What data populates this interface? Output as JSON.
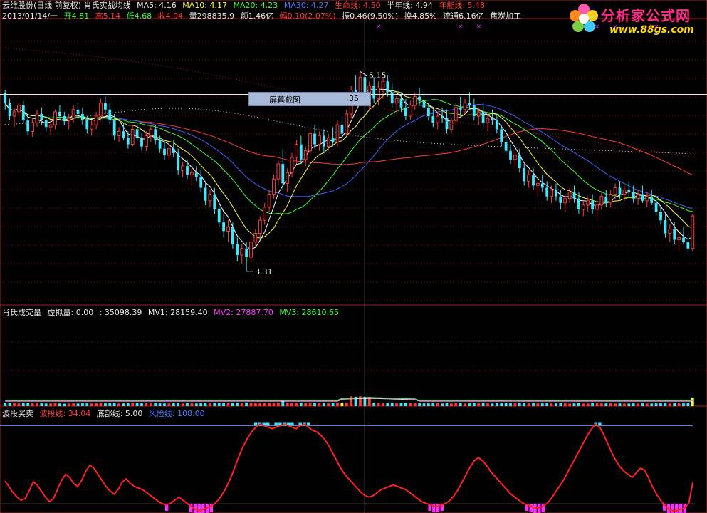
{
  "header": {
    "title": "云维股份(日线 前复权) 肖氏实战均线",
    "ma5": "MA5: 4.16",
    "ma10": "MA10: 4.17",
    "ma20": "MA20: 4.23",
    "ma30": "MA30: 4.27",
    "life_line": "生命线: 4.50",
    "half_year": "半年线: 4.94",
    "annual_line": "年能线: 5.48",
    "date": "2013/01/14/一",
    "open": "开4.81",
    "high": "高5.14",
    "low": "低4.68",
    "close": "收4.94",
    "volume": "量298835.9",
    "amount": "额1.46亿",
    "change": "幅0.10(2.07%)",
    "amplitude": "振0.46(9.50%)",
    "turnover": "换4.85%",
    "float": "流通6.16亿",
    "industry": "焦炭加工"
  },
  "logo": {
    "title": "分析家公式网",
    "url": "www.88gs.com"
  },
  "tooltip": {
    "label": "屏幕截图",
    "value": "35"
  },
  "volume_panel": {
    "title": "肖氏成交量",
    "virtual": "虚拟量: 0.00",
    "value": ": 35098.39",
    "mv1": "MV1: 28159.40",
    "mv2": "MV2: 27887.70",
    "mv3": "MV3: 28610.65"
  },
  "osc_panel": {
    "title": "波段买卖",
    "band": "波段线: 34.04",
    "bottom": "底部线: 5.00",
    "risk": "风险线: 108.00"
  },
  "colors": {
    "up": "#ff3a3a",
    "down": "#40e8ff",
    "ma5": "#ffffff",
    "ma10": "#ffff40",
    "ma20": "#3aff3a",
    "ma30": "#4060ff",
    "life": "#ff3a3a",
    "grid": "#7a1010"
  },
  "chart_data": [
    {
      "type": "candlestick",
      "title": "云维股份(日线 前复权) 肖氏实战均线",
      "ylim": [
        3.0,
        5.6
      ],
      "crosshair_price": 4.94,
      "annotations": [
        {
          "text": "5.15",
          "index": 78,
          "value": 5.15
        },
        {
          "text": "3.31",
          "index": 53,
          "value": 3.31
        }
      ],
      "ohlc": [
        [
          4.95,
          4.98,
          4.8,
          4.86
        ],
        [
          4.86,
          4.9,
          4.7,
          4.74
        ],
        [
          4.74,
          4.82,
          4.64,
          4.78
        ],
        [
          4.78,
          4.86,
          4.72,
          4.84
        ],
        [
          4.84,
          4.88,
          4.68,
          4.7
        ],
        [
          4.7,
          4.76,
          4.56,
          4.6
        ],
        [
          4.6,
          4.72,
          4.55,
          4.68
        ],
        [
          4.68,
          4.8,
          4.64,
          4.76
        ],
        [
          4.76,
          4.82,
          4.66,
          4.7
        ],
        [
          4.7,
          4.74,
          4.6,
          4.64
        ],
        [
          4.64,
          4.7,
          4.56,
          4.66
        ],
        [
          4.66,
          4.8,
          4.62,
          4.78
        ],
        [
          4.78,
          4.84,
          4.7,
          4.74
        ],
        [
          4.74,
          4.78,
          4.66,
          4.7
        ],
        [
          4.7,
          4.76,
          4.62,
          4.72
        ],
        [
          4.72,
          4.84,
          4.68,
          4.8
        ],
        [
          4.8,
          4.86,
          4.72,
          4.76
        ],
        [
          4.76,
          4.82,
          4.66,
          4.7
        ],
        [
          4.7,
          4.74,
          4.58,
          4.62
        ],
        [
          4.62,
          4.7,
          4.56,
          4.66
        ],
        [
          4.66,
          4.78,
          4.62,
          4.74
        ],
        [
          4.74,
          4.9,
          4.7,
          4.86
        ],
        [
          4.86,
          4.92,
          4.76,
          4.8
        ],
        [
          4.8,
          4.86,
          4.66,
          4.7
        ],
        [
          4.7,
          4.76,
          4.52,
          4.56
        ],
        [
          4.56,
          4.64,
          4.5,
          4.6
        ],
        [
          4.6,
          4.68,
          4.52,
          4.54
        ],
        [
          4.54,
          4.6,
          4.44,
          4.48
        ],
        [
          4.48,
          4.66,
          4.46,
          4.62
        ],
        [
          4.62,
          4.68,
          4.5,
          4.54
        ],
        [
          4.54,
          4.58,
          4.42,
          4.46
        ],
        [
          4.46,
          4.6,
          4.42,
          4.56
        ],
        [
          4.56,
          4.66,
          4.5,
          4.62
        ],
        [
          4.62,
          4.66,
          4.48,
          4.52
        ],
        [
          4.52,
          4.56,
          4.4,
          4.44
        ],
        [
          4.44,
          4.5,
          4.34,
          4.38
        ],
        [
          4.38,
          4.48,
          4.34,
          4.44
        ],
        [
          4.44,
          4.52,
          4.36,
          4.4
        ],
        [
          4.4,
          4.44,
          4.2,
          4.24
        ],
        [
          4.24,
          4.32,
          4.18,
          4.28
        ],
        [
          4.28,
          4.34,
          4.16,
          4.2
        ],
        [
          4.2,
          4.26,
          4.1,
          4.22
        ],
        [
          4.22,
          4.28,
          4.14,
          4.18
        ],
        [
          4.18,
          4.24,
          4.04,
          4.08
        ],
        [
          4.08,
          4.14,
          3.92,
          3.96
        ],
        [
          3.96,
          4.06,
          3.9,
          4.02
        ],
        [
          4.02,
          4.08,
          3.84,
          3.88
        ],
        [
          3.88,
          3.94,
          3.72,
          3.76
        ],
        [
          3.76,
          3.84,
          3.62,
          3.68
        ],
        [
          3.68,
          3.78,
          3.58,
          3.72
        ],
        [
          3.72,
          3.76,
          3.52,
          3.56
        ],
        [
          3.56,
          3.62,
          3.4,
          3.46
        ],
        [
          3.46,
          3.56,
          3.38,
          3.52
        ],
        [
          3.52,
          3.58,
          3.31,
          3.44
        ],
        [
          3.44,
          3.62,
          3.4,
          3.58
        ],
        [
          3.58,
          3.7,
          3.54,
          3.66
        ],
        [
          3.66,
          3.82,
          3.62,
          3.78
        ],
        [
          3.78,
          3.94,
          3.74,
          3.9
        ],
        [
          3.9,
          4.06,
          3.86,
          4.02
        ],
        [
          4.02,
          4.2,
          3.98,
          4.16
        ],
        [
          4.16,
          4.34,
          4.1,
          4.3
        ],
        [
          4.3,
          4.44,
          4.06,
          4.12
        ],
        [
          4.12,
          4.26,
          4.04,
          4.22
        ],
        [
          4.22,
          4.4,
          4.18,
          4.36
        ],
        [
          4.36,
          4.52,
          4.3,
          4.48
        ],
        [
          4.48,
          4.56,
          4.3,
          4.34
        ],
        [
          4.34,
          4.46,
          4.28,
          4.42
        ],
        [
          4.42,
          4.62,
          4.38,
          4.58
        ],
        [
          4.58,
          4.66,
          4.44,
          4.48
        ],
        [
          4.48,
          4.6,
          4.42,
          4.56
        ],
        [
          4.56,
          4.62,
          4.4,
          4.46
        ],
        [
          4.46,
          4.58,
          4.42,
          4.54
        ],
        [
          4.54,
          4.64,
          4.46,
          4.5
        ],
        [
          4.5,
          4.7,
          4.46,
          4.66
        ],
        [
          4.66,
          4.74,
          4.54,
          4.58
        ],
        [
          4.58,
          4.8,
          4.56,
          4.76
        ],
        [
          4.76,
          5.02,
          4.72,
          4.98
        ],
        [
          4.98,
          5.12,
          4.86,
          4.92
        ],
        [
          4.92,
          5.15,
          4.84,
          5.1
        ],
        [
          5.1,
          5.14,
          4.88,
          4.94
        ],
        [
          4.94,
          5.06,
          4.8,
          5.02
        ],
        [
          5.02,
          5.1,
          4.86,
          4.9
        ],
        [
          4.9,
          5.06,
          4.84,
          5.0
        ],
        [
          5.0,
          5.1,
          4.9,
          5.06
        ],
        [
          5.06,
          5.12,
          4.92,
          4.96
        ],
        [
          4.96,
          5.04,
          4.82,
          4.86
        ],
        [
          4.86,
          4.94,
          4.76,
          4.9
        ],
        [
          4.9,
          4.96,
          4.78,
          4.82
        ],
        [
          4.82,
          4.9,
          4.7,
          4.74
        ],
        [
          4.74,
          4.88,
          4.7,
          4.84
        ],
        [
          4.84,
          4.96,
          4.8,
          4.92
        ],
        [
          4.92,
          5.0,
          4.84,
          4.88
        ],
        [
          4.88,
          4.96,
          4.8,
          4.82
        ],
        [
          4.82,
          4.86,
          4.7,
          4.74
        ],
        [
          4.74,
          4.8,
          4.64,
          4.68
        ],
        [
          4.68,
          4.78,
          4.62,
          4.74
        ],
        [
          4.74,
          4.82,
          4.68,
          4.72
        ],
        [
          4.72,
          4.8,
          4.58,
          4.62
        ],
        [
          4.62,
          4.72,
          4.58,
          4.7
        ],
        [
          4.7,
          4.86,
          4.66,
          4.82
        ],
        [
          4.82,
          4.92,
          4.74,
          4.8
        ],
        [
          4.8,
          4.9,
          4.76,
          4.86
        ],
        [
          4.86,
          4.96,
          4.8,
          4.84
        ],
        [
          4.84,
          4.9,
          4.7,
          4.74
        ],
        [
          4.74,
          4.82,
          4.66,
          4.78
        ],
        [
          4.78,
          4.86,
          4.64,
          4.68
        ],
        [
          4.68,
          4.76,
          4.6,
          4.72
        ],
        [
          4.72,
          4.8,
          4.66,
          4.7
        ],
        [
          4.7,
          4.76,
          4.58,
          4.62
        ],
        [
          4.62,
          4.66,
          4.46,
          4.5
        ],
        [
          4.5,
          4.56,
          4.38,
          4.42
        ],
        [
          4.42,
          4.48,
          4.3,
          4.34
        ],
        [
          4.34,
          4.42,
          4.26,
          4.38
        ],
        [
          4.38,
          4.44,
          4.22,
          4.26
        ],
        [
          4.26,
          4.3,
          4.1,
          4.14
        ],
        [
          4.14,
          4.24,
          4.08,
          4.2
        ],
        [
          4.2,
          4.26,
          4.06,
          4.1
        ],
        [
          4.1,
          4.16,
          4.0,
          4.12
        ],
        [
          4.12,
          4.2,
          4.04,
          4.08
        ],
        [
          4.08,
          4.14,
          3.96,
          4.0
        ],
        [
          4.0,
          4.1,
          3.94,
          4.06
        ],
        [
          4.06,
          4.12,
          3.96,
          4.0
        ],
        [
          4.0,
          4.06,
          3.88,
          3.94
        ],
        [
          3.94,
          4.02,
          3.86,
          3.98
        ],
        [
          3.98,
          4.08,
          3.94,
          4.04
        ],
        [
          4.04,
          4.1,
          3.94,
          3.98
        ],
        [
          3.98,
          4.04,
          3.84,
          3.88
        ],
        [
          3.88,
          3.96,
          3.82,
          3.92
        ],
        [
          3.92,
          4.0,
          3.86,
          3.96
        ],
        [
          3.96,
          4.02,
          3.84,
          3.88
        ],
        [
          3.88,
          3.96,
          3.8,
          3.92
        ],
        [
          3.92,
          4.04,
          3.88,
          4.0
        ],
        [
          4.0,
          4.06,
          3.9,
          3.94
        ],
        [
          3.94,
          4.06,
          3.9,
          4.02
        ],
        [
          4.02,
          4.12,
          3.98,
          4.08
        ],
        [
          4.08,
          4.14,
          3.98,
          4.02
        ],
        [
          4.02,
          4.1,
          3.96,
          4.06
        ],
        [
          4.06,
          4.14,
          4.0,
          4.04
        ],
        [
          4.04,
          4.1,
          3.94,
          3.98
        ],
        [
          3.98,
          4.06,
          3.92,
          4.02
        ],
        [
          4.02,
          4.1,
          3.94,
          3.96
        ],
        [
          3.96,
          4.04,
          3.9,
          4.0
        ],
        [
          4.0,
          4.06,
          3.92,
          3.94
        ],
        [
          3.94,
          3.98,
          3.82,
          3.86
        ],
        [
          3.86,
          3.92,
          3.74,
          3.78
        ],
        [
          3.78,
          3.84,
          3.62,
          3.66
        ],
        [
          3.66,
          3.74,
          3.58,
          3.7
        ],
        [
          3.7,
          3.76,
          3.56,
          3.6
        ],
        [
          3.6,
          3.66,
          3.5,
          3.62
        ],
        [
          3.62,
          3.72,
          3.56,
          3.58
        ],
        [
          3.58,
          3.64,
          3.46,
          3.52
        ],
        [
          3.52,
          3.84,
          3.5,
          3.82
        ]
      ]
    },
    {
      "type": "bar",
      "title": "肖氏成交量",
      "note": "volume sub-panel, values in 万手 scale relative",
      "series": [
        {
          "name": "MV1",
          "last": 28159.4
        },
        {
          "name": "MV2",
          "last": 27887.7
        },
        {
          "name": "MV3",
          "last": 28610.65
        }
      ],
      "last_value": 35098.39
    },
    {
      "type": "line",
      "title": "波段买卖",
      "ylim": [
        -5,
        115
      ],
      "reference_lines": [
        {
          "name": "底部线",
          "value": 5.0
        },
        {
          "name": "风险线",
          "value": 108.0
        }
      ],
      "series": [
        {
          "name": "波段线",
          "values": [
            35,
            28,
            20,
            14,
            10,
            12,
            22,
            34,
            30,
            22,
            14,
            8,
            12,
            24,
            36,
            44,
            40,
            32,
            28,
            36,
            48,
            56,
            52,
            44,
            36,
            28,
            22,
            18,
            24,
            34,
            38,
            32,
            28,
            26,
            24,
            20,
            16,
            12,
            8,
            5,
            4,
            6,
            10,
            14,
            10,
            6,
            2,
            -2,
            -4,
            -2,
            0,
            2,
            6,
            12,
            20,
            30,
            42,
            56,
            70,
            82,
            92,
            100,
            106,
            110,
            108,
            106,
            104,
            106,
            108,
            110,
            108,
            106,
            104,
            108,
            110,
            106,
            102,
            100,
            96,
            90,
            82,
            72,
            62,
            52,
            44,
            38,
            32,
            26,
            20,
            16,
            14,
            16,
            20,
            24,
            26,
            28,
            30,
            28,
            26,
            24,
            20,
            16,
            12,
            8,
            6,
            4,
            2,
            2,
            4,
            6,
            10,
            16,
            24,
            34,
            44,
            54,
            62,
            66,
            62,
            56,
            48,
            42,
            36,
            30,
            24,
            18,
            14,
            10,
            6,
            4,
            2,
            0,
            0,
            2,
            6,
            12,
            20,
            28,
            36,
            46,
            56,
            66,
            76,
            86,
            96,
            104,
            110,
            106,
            96,
            84,
            72,
            62,
            54,
            48,
            44,
            40,
            46,
            52,
            50,
            40,
            28,
            18,
            10,
            4,
            -2,
            -4,
            -4,
            -2,
            0,
            6,
            34
          ]
        }
      ]
    }
  ]
}
